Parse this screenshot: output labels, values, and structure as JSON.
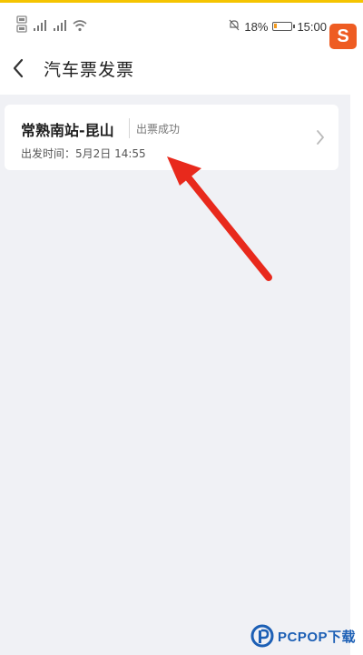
{
  "status_bar": {
    "battery_percent": "18%",
    "battery_level": 0.18,
    "time": "15:00",
    "icons": [
      "sim-card-icon",
      "signal-icon",
      "signal-icon",
      "wifi-icon",
      "mute-bell-icon",
      "battery-icon"
    ]
  },
  "nav": {
    "title": "汽车票发票",
    "back_icon": "chevron-left-icon"
  },
  "ticket": {
    "route": "常熟南站-昆山",
    "status": "出票成功",
    "depart_time": "出发时间：5月2日 14:55",
    "icon": "chevron-right-icon"
  },
  "overlay": {
    "arrow_color": "#e8291c",
    "badge_letter": "S",
    "badge_color": "#ee5c22",
    "watermark": "PCPOP下载",
    "watermark_color": "#1c5fb5"
  }
}
